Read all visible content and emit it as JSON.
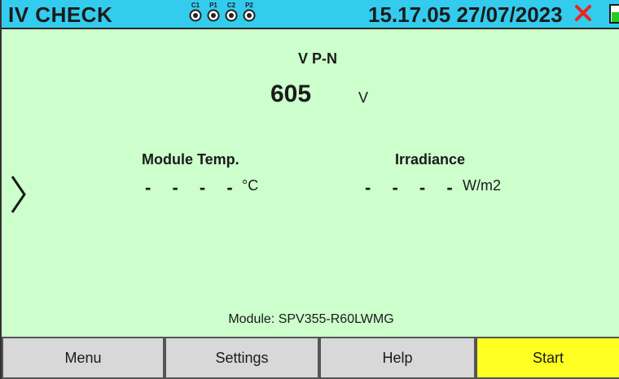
{
  "header": {
    "title": "IV CHECK",
    "connectors": [
      "C1",
      "P1",
      "C2",
      "P2"
    ],
    "time": "15.17.05",
    "date": "27/07/2023",
    "status_icon": "red-x-icon",
    "battery_icon": "battery-icon"
  },
  "measure": {
    "vpn_label": "V P-N",
    "vpn_value": "605",
    "vpn_unit": "V"
  },
  "temp": {
    "label": "Module Temp.",
    "value": "- - - -",
    "unit": "°C"
  },
  "irradiance": {
    "label": "Irradiance",
    "value": "- - - -",
    "unit": "W/m2"
  },
  "module": {
    "text": "Module: SPV355-R60LWMG"
  },
  "softkeys": {
    "menu": "Menu",
    "settings": "Settings",
    "help": "Help",
    "start": "Start"
  },
  "colors": {
    "header_bg": "#33ccee",
    "screen_bg": "#ccffcc",
    "button_bg": "#d8d8d8",
    "start_bg": "#ffff22",
    "status_x": "#ee2222"
  }
}
